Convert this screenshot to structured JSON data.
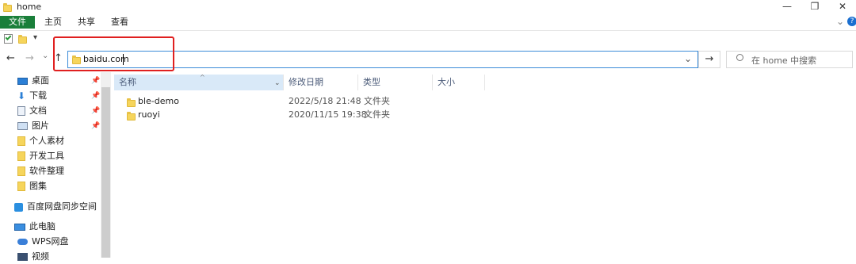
{
  "window": {
    "title": "home",
    "controls": {
      "minimize": "—",
      "maximize": "❐",
      "close": "✕"
    }
  },
  "ribbon": {
    "tabs": [
      {
        "label": "文件",
        "active": true
      },
      {
        "label": "主页"
      },
      {
        "label": "共享"
      },
      {
        "label": "查看"
      }
    ],
    "expand": "⌄",
    "help": "?"
  },
  "address": {
    "value": "baidu.com",
    "dropdown": "⌄",
    "go": "→"
  },
  "nav_buttons": {
    "back": "←",
    "forward": "→",
    "recent": "⌄",
    "up": "↑"
  },
  "search": {
    "placeholder": "在 home 中搜索"
  },
  "sidebar": {
    "items": [
      {
        "label": "桌面",
        "icon": "desktop-icon",
        "pinned": true
      },
      {
        "label": "下载",
        "icon": "download-icon",
        "pinned": true
      },
      {
        "label": "文档",
        "icon": "document-icon",
        "pinned": true
      },
      {
        "label": "图片",
        "icon": "picture-icon",
        "pinned": true
      },
      {
        "label": "个人素材",
        "icon": "folder-icon"
      },
      {
        "label": "开发工具",
        "icon": "folder-icon"
      },
      {
        "label": "软件整理",
        "icon": "folder-icon"
      },
      {
        "label": "图集",
        "icon": "folder-icon"
      },
      {
        "label": "百度网盘同步空间",
        "icon": "baidu-netdisk-icon"
      },
      {
        "label": "此电脑",
        "icon": "pc-icon"
      },
      {
        "label": "WPS网盘",
        "icon": "cloud-icon"
      },
      {
        "label": "视频",
        "icon": "video-icon"
      }
    ]
  },
  "file_list": {
    "columns": [
      "名称",
      "修改日期",
      "类型",
      "大小"
    ],
    "rows": [
      {
        "name": "ble-demo",
        "modified": "2022/5/18 21:48",
        "type": "文件夹",
        "size": ""
      },
      {
        "name": "ruoyi",
        "modified": "2020/11/15 19:38",
        "type": "文件夹",
        "size": ""
      }
    ]
  },
  "colors": {
    "accent": "#1a7f3a",
    "address_border": "#3c8cd8",
    "highlight_box": "#e02020",
    "folder": "#f6d55c"
  }
}
